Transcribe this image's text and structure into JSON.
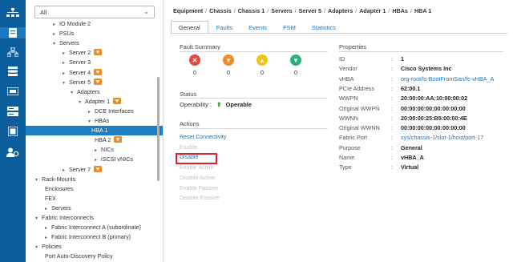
{
  "nav_rail": {
    "icons": [
      "equipment-icon",
      "servers-icon",
      "lan-icon",
      "san-icon",
      "vm-icon",
      "storage-icon",
      "chassis-icon",
      "admin-icon"
    ]
  },
  "tree": {
    "filter_value": "All",
    "nodes": [
      {
        "label": "IO Module 2",
        "arrow": "▸",
        "warn": false
      },
      {
        "label": "PSUs",
        "arrow": "▸",
        "warn": false
      },
      {
        "label": "Servers",
        "arrow": "▾",
        "warn": false
      },
      {
        "label": "Server 2",
        "arrow": "▸",
        "warn": true
      },
      {
        "label": "Server 3",
        "arrow": "▸",
        "warn": false
      },
      {
        "label": "Server 4",
        "arrow": "▸",
        "warn": true
      },
      {
        "label": "Server 5",
        "arrow": "▾",
        "warn": true
      },
      {
        "label": "Adapters",
        "arrow": "▾",
        "warn": false
      },
      {
        "label": "Adapter 1",
        "arrow": "▾",
        "warn": true
      },
      {
        "label": "DCE Interfaces",
        "arrow": "▸",
        "warn": false
      },
      {
        "label": "HBAs",
        "arrow": "▾",
        "warn": false
      },
      {
        "label": "HBA 1",
        "arrow": "",
        "warn": false
      },
      {
        "label": "HBA 2",
        "arrow": "",
        "warn": true
      },
      {
        "label": "NICs",
        "arrow": "▸",
        "warn": false
      },
      {
        "label": "iSCSI vNICs",
        "arrow": "▸",
        "warn": false
      },
      {
        "label": "Server 7",
        "arrow": "▸",
        "warn": true
      },
      {
        "label": "Rack-Mounts",
        "arrow": "▾",
        "warn": false
      },
      {
        "label": "Enclosures",
        "arrow": "",
        "warn": false
      },
      {
        "label": "FEX",
        "arrow": "",
        "warn": false
      },
      {
        "label": "Servers",
        "arrow": "▸",
        "warn": false
      },
      {
        "label": "Fabric Interconnects",
        "arrow": "▾",
        "warn": false
      },
      {
        "label": "Fabric Interconnect A (subordinate)",
        "arrow": "▸",
        "warn": false
      },
      {
        "label": "Fabric Interconnect B (primary)",
        "arrow": "▸",
        "warn": false
      },
      {
        "label": "Policies",
        "arrow": "▾",
        "warn": false
      },
      {
        "label": "Port Auto-Discovery Policy",
        "arrow": "",
        "warn": false
      }
    ]
  },
  "breadcrumb": [
    "Equipment",
    "Chassis",
    "Chassis 1",
    "Servers",
    "Server 5",
    "Adapters",
    "Adapter 1",
    "HBAs",
    "HBA 1"
  ],
  "tabs": [
    "General",
    "Faults",
    "Events",
    "FSM",
    "Statistics"
  ],
  "fault_summary": {
    "title": "Fault Summary",
    "counts": [
      {
        "severity": "critical",
        "icon": "critical-fault-icon",
        "color": "#e04848",
        "glyph": "✕",
        "count": "0"
      },
      {
        "severity": "major",
        "icon": "major-fault-icon",
        "color": "#f08a24",
        "glyph": "▼",
        "count": "0"
      },
      {
        "severity": "minor",
        "icon": "minor-fault-icon",
        "color": "#f2c318",
        "glyph": "▲",
        "count": "0"
      },
      {
        "severity": "warning",
        "icon": "warning-fault-icon",
        "color": "#2fb07a",
        "glyph": "▼",
        "count": "0"
      }
    ]
  },
  "status": {
    "title": "Status",
    "label": "Operability",
    "value": "Operable"
  },
  "actions": {
    "title": "Actions",
    "items": [
      {
        "label": "Reset Connectivity",
        "enabled": true
      },
      {
        "label": "Enable",
        "enabled": false
      },
      {
        "label": "Disable",
        "enabled": true
      },
      {
        "label": "Enable Active",
        "enabled": false
      },
      {
        "label": "Disable Active",
        "enabled": false
      },
      {
        "label": "Enable Passive",
        "enabled": false
      },
      {
        "label": "Disable Passive",
        "enabled": false
      }
    ]
  },
  "properties": {
    "title": "Properties",
    "rows": [
      {
        "label": "ID",
        "value": "1",
        "link": false
      },
      {
        "label": "Vendor",
        "value": "Cisco Systems Inc",
        "link": false
      },
      {
        "label": "vHBA",
        "value": "org-root/ls-BootFromSan/fc-vHBA_A",
        "link": true
      },
      {
        "label": "PCIe Address",
        "value": "62:00.1",
        "link": false
      },
      {
        "label": "WWPN",
        "value": "20:00:00:AA:10:00:00:02",
        "link": false
      },
      {
        "label": "Original WWPN",
        "value": "00:00:00:00:00:00:00:00",
        "link": false
      },
      {
        "label": "WWNN",
        "value": "20:00:00:25:B5:00:00:4E",
        "link": false
      },
      {
        "label": "Original WWNN",
        "value": "00:00:00:00:00:00:00:00",
        "link": false
      },
      {
        "label": "Fabric Port",
        "value": "sys/chassis-1/slot-1/host/port-17",
        "link": true
      },
      {
        "label": "Purpose",
        "value": "General",
        "link": false
      },
      {
        "label": "Name",
        "value": "vHBA_A",
        "link": false
      },
      {
        "label": "Type",
        "value": "Virtual",
        "link": false
      }
    ]
  }
}
